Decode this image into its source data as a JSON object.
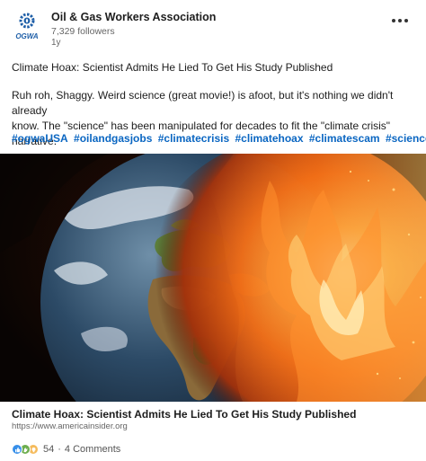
{
  "post": {
    "author": "Oil & Gas Workers Association",
    "logo_text": "OGWA",
    "followers": "7,329 followers",
    "age": "1y",
    "title_line": "Climate Hoax: Scientist Admits He Lied To Get His Study Published",
    "body_line1": "Ruh roh, Shaggy. Weird science (great movie!) is afoot, but it's nothing we didn't already",
    "body_line2": "know. The \"science\" has been manipulated for decades to fit the \"climate crisis\" narrative.",
    "hashtags": [
      "#ogwaUSA",
      "#oilandgasjobs",
      "#climatecrisis",
      "#climatehoax",
      "#climatescam",
      "#science"
    ]
  },
  "link_preview": {
    "title": "Climate Hoax: Scientist Admits He Lied To Get His Study Published",
    "url": "https://www.americainsider.org"
  },
  "social": {
    "reaction_count": "54",
    "separator": "·",
    "comments": "4 Comments",
    "reactions": [
      "like-icon",
      "celebrate-icon",
      "insightful-icon"
    ]
  },
  "colors": {
    "hashtag": "#0a66c2",
    "like": "#378fe9"
  }
}
